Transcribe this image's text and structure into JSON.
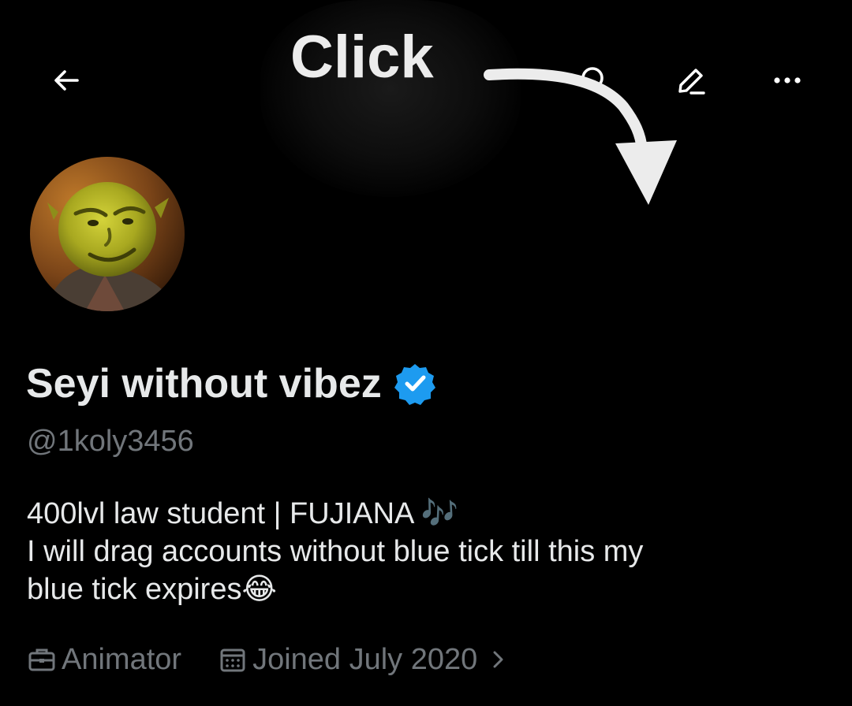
{
  "header": {
    "back_icon": "arrow-left-icon",
    "search_icon": "search-icon",
    "edit_icon": "pencil-icon",
    "more_icon": "more-horizontal-icon"
  },
  "annotation": {
    "text": "Click"
  },
  "profile": {
    "avatar_icon": "shrek-avatar",
    "display_name": "Seyi without vibez",
    "verified_icon": "verified-badge-icon",
    "verified_color": "#1d9bf0",
    "handle": "@1koly3456",
    "bio_lines": [
      "400lvl law student | FUJIANA 🎶",
      "I will drag accounts without blue tick till this my",
      "blue tick expires😂"
    ],
    "profession_icon": "briefcase-icon",
    "profession": "Animator",
    "joined_icon": "calendar-icon",
    "joined": "Joined July 2020",
    "chevron_icon": "chevron-right-icon"
  },
  "colors": {
    "background": "#000000",
    "text_primary": "#e7e9ea",
    "text_secondary": "#71767b",
    "accent": "#1d9bf0"
  }
}
